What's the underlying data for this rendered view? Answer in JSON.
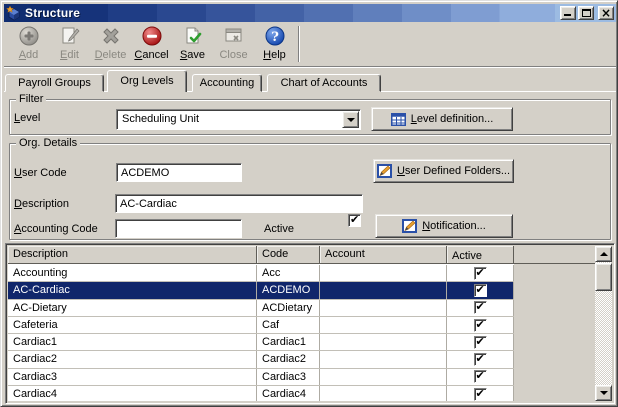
{
  "window": {
    "title": "Structure"
  },
  "titlebar": {
    "minimize": "minimize",
    "maximize": "maximize",
    "close": "close"
  },
  "toolbar": {
    "buttons": [
      {
        "key": "add",
        "u": "A",
        "rest": "dd",
        "enabled": false
      },
      {
        "key": "edit",
        "u": "E",
        "rest": "dit",
        "enabled": false
      },
      {
        "key": "delete",
        "u": "D",
        "rest": "elete",
        "enabled": false
      },
      {
        "key": "cancel",
        "u": "C",
        "rest": "ancel",
        "enabled": true
      },
      {
        "key": "save",
        "u": "S",
        "rest": "ave",
        "enabled": true
      },
      {
        "key": "close",
        "u": "",
        "rest": "Close",
        "enabled": false
      },
      {
        "key": "help",
        "u": "H",
        "rest": "elp",
        "enabled": true
      }
    ]
  },
  "tabs": [
    {
      "label": "Payroll Groups",
      "active": false
    },
    {
      "label": "Org Levels",
      "active": true
    },
    {
      "label": "Accounting",
      "active": false
    },
    {
      "label": "Chart of Accounts",
      "active": false
    }
  ],
  "filter": {
    "legend": "Filter",
    "level_label": {
      "u": "L",
      "rest": "evel"
    },
    "level_value": "Scheduling Unit",
    "level_definition_button": {
      "u": "L",
      "rest": "evel definition..."
    }
  },
  "org_details": {
    "legend": "Org. Details",
    "user_code_label": {
      "u": "U",
      "rest": "ser Code"
    },
    "user_code_value": "ACDEMO",
    "description_label": {
      "u": "D",
      "rest": "escription"
    },
    "description_value": "AC-Cardiac",
    "accounting_code_label": {
      "u": "A",
      "rest": "ccounting Code"
    },
    "accounting_code_value": "",
    "active_label": "Active",
    "active_checked": true,
    "user_defined_folders_button": {
      "u": "U",
      "rest": "ser Defined Folders..."
    },
    "notification_button": {
      "u": "N",
      "rest": "otification..."
    }
  },
  "grid": {
    "columns": [
      "Description",
      "Code",
      "Account",
      "Active"
    ],
    "rows": [
      {
        "description": "Accounting",
        "code": "Acc",
        "account": "",
        "active": true,
        "selected": false
      },
      {
        "description": "AC-Cardiac",
        "code": "ACDEMO",
        "account": "",
        "active": true,
        "selected": true
      },
      {
        "description": "AC-Dietary",
        "code": "ACDietary",
        "account": "",
        "active": true,
        "selected": false
      },
      {
        "description": "Cafeteria",
        "code": "Caf",
        "account": "",
        "active": true,
        "selected": false
      },
      {
        "description": "Cardiac1",
        "code": "Cardiac1",
        "account": "",
        "active": true,
        "selected": false
      },
      {
        "description": "Cardiac2",
        "code": "Cardiac2",
        "account": "",
        "active": true,
        "selected": false
      },
      {
        "description": "Cardiac3",
        "code": "Cardiac3",
        "account": "",
        "active": true,
        "selected": false
      },
      {
        "description": "Cardiac4",
        "code": "Cardiac4",
        "account": "",
        "active": true,
        "selected": false
      }
    ]
  },
  "colors": {
    "titlebar_start": "#0f2c70",
    "titlebar_end": "#9cbbe2",
    "selection": "#10266b",
    "window_bg": "#d4d0c8"
  }
}
